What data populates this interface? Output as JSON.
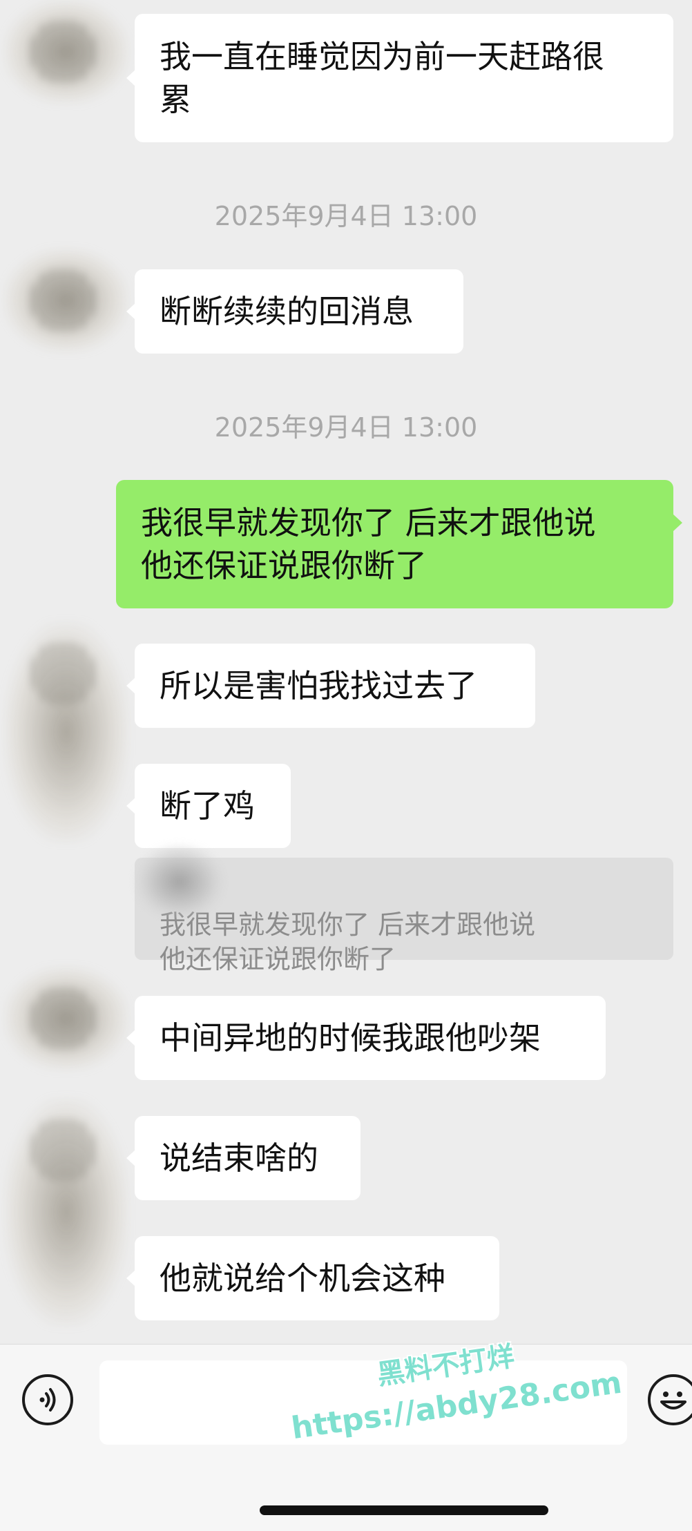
{
  "messages": [
    {
      "text": "我一直在睡觉因为前一天赶路很\n累"
    },
    {
      "text": "断断续续的回消息"
    },
    {
      "text": "我很早就发现你了 后来才跟他说\n他还保证说跟你断了"
    },
    {
      "text": "所以是害怕我找过去了"
    },
    {
      "text": "断了鸡"
    },
    {
      "text": "中间异地的时候我跟他吵架"
    },
    {
      "text": "说结束啥的"
    },
    {
      "text": "他就说给个机会这种"
    }
  ],
  "timestamps": [
    "2025年9月4日 13:00",
    "2025年9月4日 13:00"
  ],
  "quote": {
    "text": "我很早就发现你了 后来才跟他说\n他还保证说跟你断了"
  },
  "watermark": {
    "line1": "黑料不打烊",
    "line2": "https://abdy28.com"
  },
  "colors": {
    "background": "#ededed",
    "my_bubble": "#95ec69",
    "other_bubble": "#ffffff"
  },
  "icons": {
    "voice": "voice-icon",
    "emoji": "emoji-icon"
  }
}
